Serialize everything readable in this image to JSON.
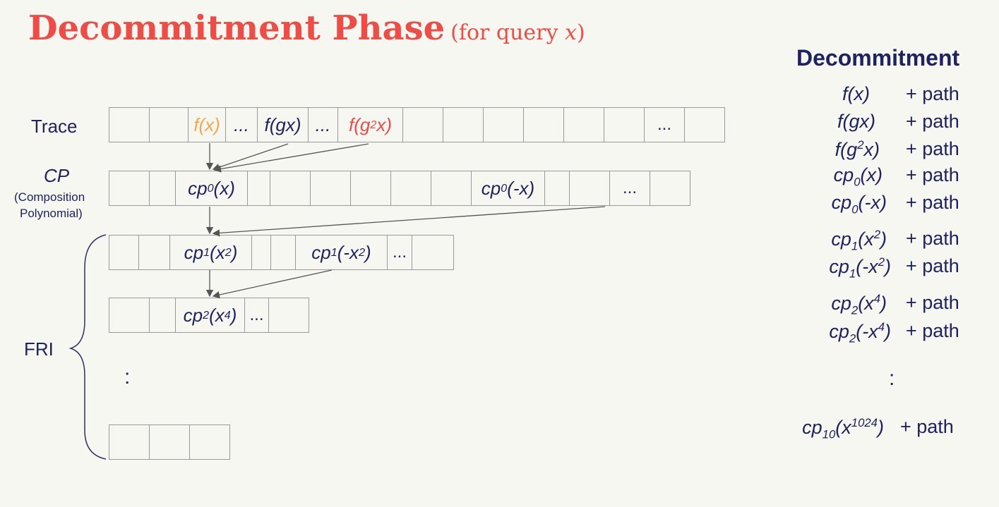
{
  "title": "Decommitment Phase",
  "subtitle_prefix": "(for query ",
  "subtitle_var": "x",
  "subtitle_suffix": ")",
  "labels": {
    "trace": "Trace",
    "cp": "CP",
    "cp_full_1": "(Composition",
    "cp_full_2": "Polynomial)",
    "fri": "FRI",
    "vdots": ":"
  },
  "ellipsis": "...",
  "trace_cells": {
    "fx": "f(x)",
    "fgx": "f(gx)",
    "fg2x_base": "f(g",
    "fg2x_sup": "2",
    "fg2x_end": "x)"
  },
  "cp_cells": {
    "cp0x": "x",
    "cp0negx": "-x"
  },
  "decommitment": {
    "heading": "Decommitment",
    "path_label": "+ path",
    "vdots": ":"
  }
}
